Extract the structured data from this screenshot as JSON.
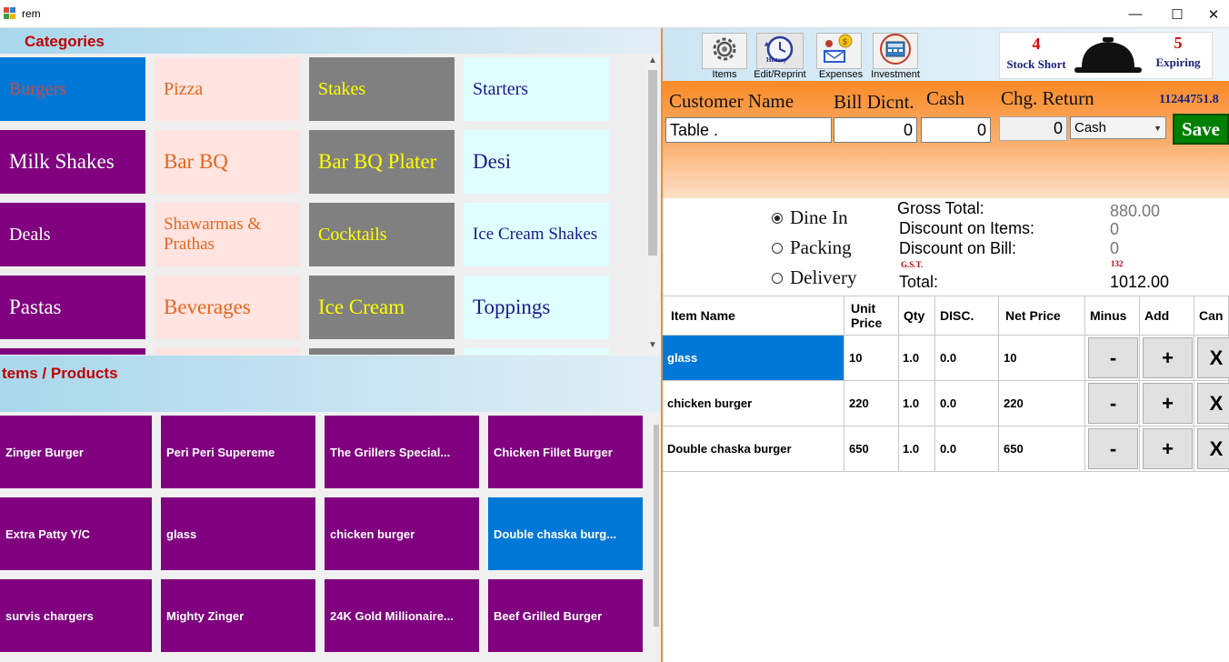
{
  "window": {
    "title": "rem",
    "minimize": "—",
    "maximize": "☐",
    "close": "✕"
  },
  "categories": {
    "header": "Categories",
    "tiles": [
      {
        "label": "Burgers",
        "bg": "#0078d7",
        "fg": "#c0504d",
        "size": "20px"
      },
      {
        "label": "Pizza",
        "bg": "#ffe4e1",
        "fg": "#e8651a",
        "size": "20px"
      },
      {
        "label": "Stakes",
        "bg": "#808080",
        "fg": "#ffff00",
        "size": "20px"
      },
      {
        "label": "Starters",
        "bg": "#e0ffff",
        "fg": "#1a1a8c",
        "size": "20px"
      },
      {
        "label": "Milk Shakes",
        "bg": "#800080",
        "fg": "#ffffff",
        "size": "23px"
      },
      {
        "label": "Bar BQ",
        "bg": "#ffe4e1",
        "fg": "#e8651a",
        "size": "23px"
      },
      {
        "label": "Bar BQ Plater",
        "bg": "#808080",
        "fg": "#ffff00",
        "size": "23px"
      },
      {
        "label": "Desi",
        "bg": "#e0ffff",
        "fg": "#1a1a8c",
        "size": "23px"
      },
      {
        "label": "Deals",
        "bg": "#800080",
        "fg": "#ffffff",
        "size": "20px"
      },
      {
        "label": "Shawarmas & Prathas",
        "bg": "#ffe4e1",
        "fg": "#e8651a",
        "size": "19px"
      },
      {
        "label": "Cocktails",
        "bg": "#808080",
        "fg": "#ffff00",
        "size": "20px"
      },
      {
        "label": "Ice Cream Shakes",
        "bg": "#e0ffff",
        "fg": "#1a1a8c",
        "size": "19px"
      },
      {
        "label": "Pastas",
        "bg": "#800080",
        "fg": "#ffffff",
        "size": "23px"
      },
      {
        "label": "Beverages",
        "bg": "#ffe4e1",
        "fg": "#e8651a",
        "size": "23px"
      },
      {
        "label": "Ice Cream",
        "bg": "#808080",
        "fg": "#ffff00",
        "size": "23px"
      },
      {
        "label": "Toppings",
        "bg": "#e0ffff",
        "fg": "#1a1a8c",
        "size": "23px"
      },
      {
        "label": "",
        "bg": "#800080",
        "fg": "#ffffff",
        "size": "20px"
      },
      {
        "label": "",
        "bg": "#ffe4e1",
        "fg": "#e8651a",
        "size": "20px"
      },
      {
        "label": "",
        "bg": "#808080",
        "fg": "#ffff00",
        "size": "20px"
      },
      {
        "label": "",
        "bg": "#e0ffff",
        "fg": "#1a1a8c",
        "size": "20px"
      }
    ]
  },
  "products": {
    "header": "tems / Products",
    "items": [
      {
        "label": "Zinger Burger",
        "bg": "#800080"
      },
      {
        "label": "Peri Peri Supereme",
        "bg": "#800080"
      },
      {
        "label": "The Grillers Special...",
        "bg": "#800080"
      },
      {
        "label": "Chicken Fillet Burger",
        "bg": "#800080"
      },
      {
        "label": "Extra Patty Y/C",
        "bg": "#800080"
      },
      {
        "label": "glass",
        "bg": "#800080"
      },
      {
        "label": "chicken burger",
        "bg": "#800080"
      },
      {
        "label": "Double chaska burg...",
        "bg": "#0078d7"
      },
      {
        "label": "survis chargers",
        "bg": "#800080"
      },
      {
        "label": "Mighty Zinger",
        "bg": "#800080"
      },
      {
        "label": "24K Gold Millionaire...",
        "bg": "#800080"
      },
      {
        "label": "Beef  Grilled Burger",
        "bg": "#800080"
      }
    ]
  },
  "toolbar": {
    "items_label": "Items",
    "history_label": "Edit/Reprint",
    "history_caption": "History",
    "expenses_label": "Expenses",
    "investment_label": "Investment",
    "stock_short_count": "4",
    "stock_short_label": "Stock Short",
    "expiring_count": "5",
    "expiring_label": "Expiring"
  },
  "bill": {
    "customer_name_label": "Customer Name",
    "bill_discount_label": "Bill Dicnt.",
    "cash_label": "Cash",
    "change_return_label": "Chg. Return",
    "order_id": "11244751.8",
    "customer_name_value": "Table .",
    "bill_discount_value": "0",
    "cash_value": "0",
    "change_return_value": "0",
    "payment_method": "Cash",
    "save_label": "Save"
  },
  "order_type": {
    "dine_in": "Dine In",
    "packing": "Packing",
    "delivery": "Delivery",
    "selected": "Dine In"
  },
  "totals": {
    "gross_label": "Gross Total:",
    "gross_value": "880.00",
    "disc_items_label": "Discount on Items:",
    "disc_items_value": "0",
    "disc_bill_label": "Discount on Bill:",
    "disc_bill_value": "0",
    "gst_label": "G.S.T.",
    "gst_value": "132",
    "total_label": "Total:",
    "total_value": "1012.00"
  },
  "cart": {
    "headers": {
      "item": "Item Name",
      "unit": "Unit Price",
      "qty": "Qty",
      "disc": "DISC.",
      "net": "Net Price",
      "minus": "Minus",
      "add": "Add",
      "cancel": "Can"
    },
    "rows": [
      {
        "item": "glass",
        "unit": "10",
        "qty": "1.0",
        "disc": "0.0",
        "net": "10",
        "minus": "-",
        "add": "+",
        "cancel": "X"
      },
      {
        "item": "chicken burger",
        "unit": "220",
        "qty": "1.0",
        "disc": "0.0",
        "net": "220",
        "minus": "-",
        "add": "+",
        "cancel": "X"
      },
      {
        "item": "Double chaska burger",
        "unit": "650",
        "qty": "1.0",
        "disc": "0.0",
        "net": "650",
        "minus": "-",
        "add": "+",
        "cancel": "X"
      }
    ]
  },
  "colors": {
    "accent_orange": "#f98a26",
    "save_green": "#008000",
    "header_red": "#c00000",
    "selection_blue": "#0078d7"
  }
}
